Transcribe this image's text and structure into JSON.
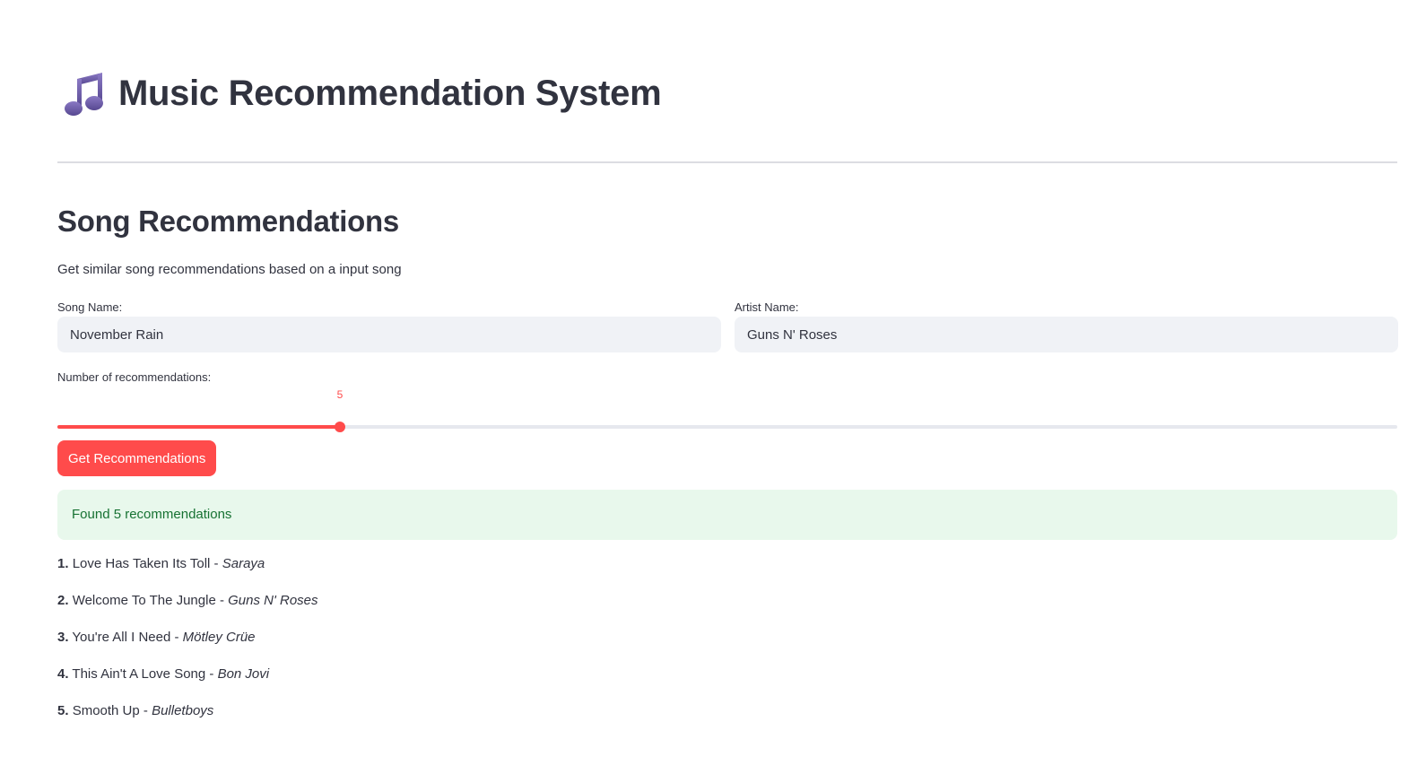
{
  "app": {
    "title": "Music Recommendation System",
    "icon": "musical-notes-icon"
  },
  "section": {
    "title": "Song Recommendations",
    "description": "Get similar song recommendations based on a input song"
  },
  "form": {
    "song_label": "Song Name:",
    "song_value": "November Rain",
    "artist_label": "Artist Name:",
    "artist_value": "Guns N' Roses",
    "slider_label": "Number of recommendations:",
    "slider_value": "5",
    "slider_min": 1,
    "slider_max": 20,
    "submit_label": "Get Recommendations"
  },
  "result": {
    "status": "Found 5 recommendations",
    "items": [
      {
        "num": "1.",
        "song": "Love Has Taken Its Toll",
        "sep": " - ",
        "artist": "Saraya"
      },
      {
        "num": "2.",
        "song": "Welcome To The Jungle",
        "sep": " - ",
        "artist": "Guns N' Roses"
      },
      {
        "num": "3.",
        "song": "You're All I Need",
        "sep": " - ",
        "artist": "Mötley Crüe"
      },
      {
        "num": "4.",
        "song": "This Ain't A Love Song",
        "sep": " - ",
        "artist": "Bon Jovi"
      },
      {
        "num": "5.",
        "song": "Smooth Up",
        "sep": " - ",
        "artist": "Bulletboys"
      }
    ]
  },
  "colors": {
    "accent": "#ff4b4b",
    "text": "#31333f",
    "input_bg": "#f0f2f6",
    "success_bg": "#e8f8ec",
    "success_text": "#177233",
    "icon": "#6b5aa3"
  }
}
